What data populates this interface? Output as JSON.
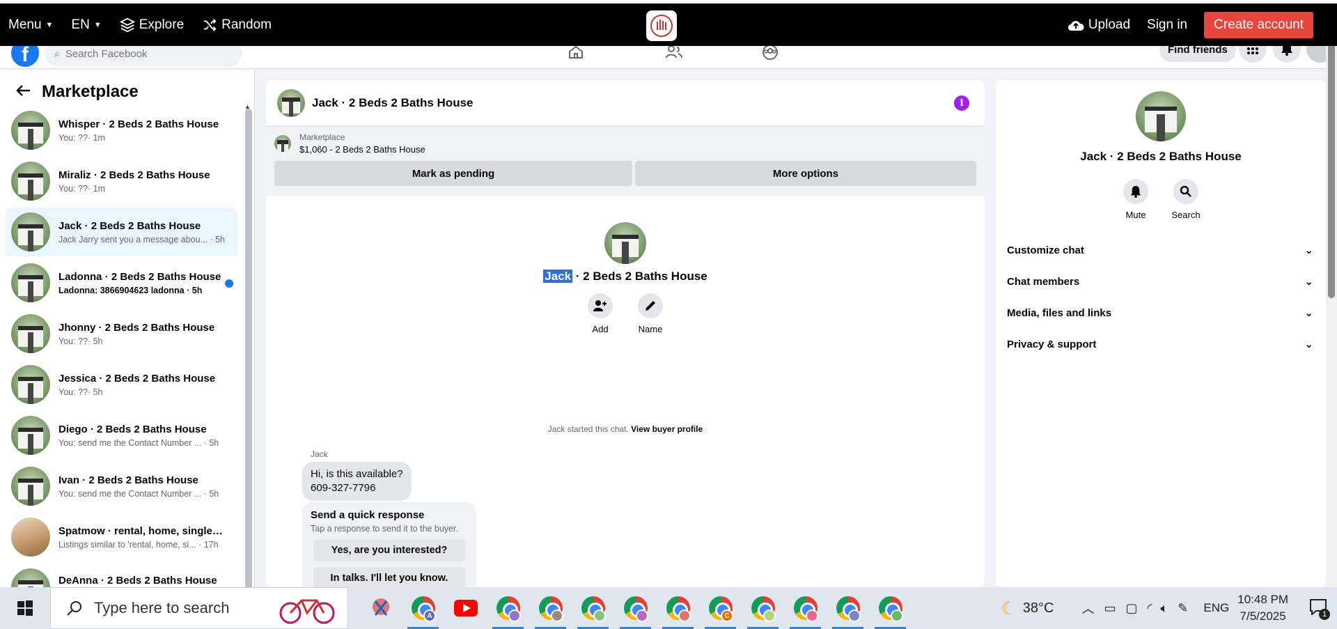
{
  "topbar": {
    "menu": "Menu",
    "lang": "EN",
    "explore": "Explore",
    "random": "Random",
    "upload": "Upload",
    "signin": "Sign in",
    "create": "Create account"
  },
  "fb": {
    "search_placeholder": "Search Facebook",
    "find_friends": "Find friends"
  },
  "sidebar": {
    "title": "Marketplace",
    "items": [
      {
        "title": "Whisper · 2 Beds 2 Baths House",
        "sub": "You: ??· 1m"
      },
      {
        "title": "Miraliz · 2 Beds 2 Baths House",
        "sub": "You: ??· 1m"
      },
      {
        "title": "Jack · 2 Beds 2 Baths House",
        "sub": "Jack Jarry sent you a message abou... · 5h"
      },
      {
        "title": "Ladonna · 2 Beds 2 Baths House",
        "sub": "Ladonna: 3866904623 ladonna · 5h"
      },
      {
        "title": "Jhonny · 2 Beds 2 Baths House",
        "sub": "You: ??· 5h"
      },
      {
        "title": "Jessica · 2 Beds 2 Baths House",
        "sub": "You: ??· 5h"
      },
      {
        "title": "Diego · 2 Beds 2 Baths House",
        "sub": "You: send me the Contact Number ... · 5h"
      },
      {
        "title": "Ivan · 2 Beds 2 Baths House",
        "sub": "You: send me the Contact Number ... · 5h"
      },
      {
        "title": "Spatmow · rental, home, single f...",
        "sub": "Listings similar to 'rental, home, si... · 17h"
      },
      {
        "title": "DeAnna · 2 Beds 2 Baths House",
        "sub": ""
      }
    ]
  },
  "chat": {
    "title": "Jack · 2 Beds 2 Baths House",
    "marketplace_label": "Marketplace",
    "listing": "$1,060 - 2 Beds 2 Baths House",
    "mark_pending": "Mark as pending",
    "more_options": "More options",
    "profile_name_highlight": "Jack",
    "profile_name_rest": " · 2 Beds 2 Baths House",
    "add_label": "Add",
    "name_label": "Name",
    "started_text": "Jack started this chat.",
    "view_profile": "View buyer profile",
    "sender": "Jack",
    "message_line1": "Hi, is this available?",
    "message_line2": "609-327-7796",
    "quick_title": "Send a quick response",
    "quick_sub": "Tap a response to send it to the buyer.",
    "quick_1": "Yes, are you interested?",
    "quick_2": "In talks. I'll let you know."
  },
  "rpanel": {
    "name": "Jack · 2 Beds 2 Baths House",
    "mute": "Mute",
    "search": "Search",
    "sections": [
      "Customize chat",
      "Chat members",
      "Media, files and links",
      "Privacy & support"
    ]
  },
  "taskbar": {
    "search_text": "Type here to search",
    "temp": "38°C",
    "lang": "ENG",
    "time": "10:48 PM",
    "date": "7/5/2025",
    "notif_count": "1"
  }
}
